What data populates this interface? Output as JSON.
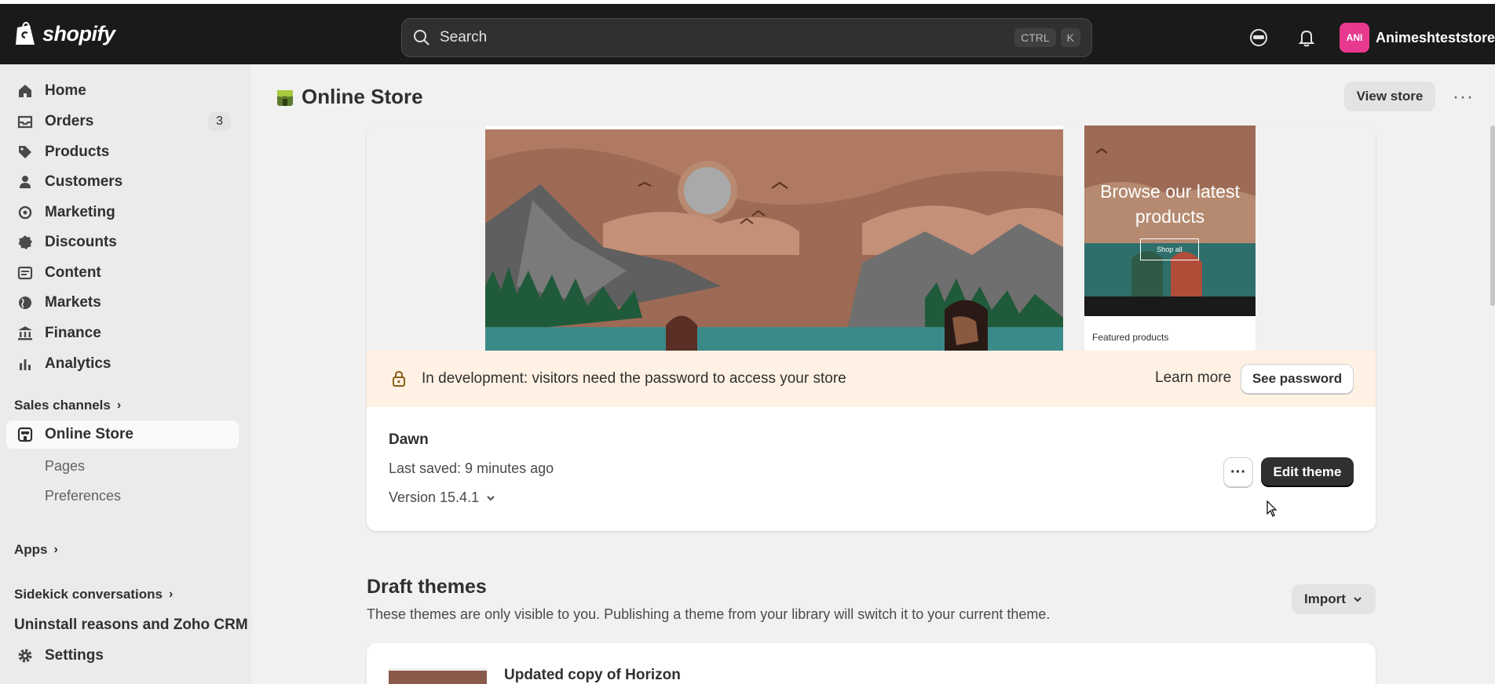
{
  "topbar": {
    "logo_text": "shopify",
    "search_placeholder": "Search",
    "kbd_ctrl": "CTRL",
    "kbd_k": "K",
    "avatar_initials": "ANI",
    "store_name": "Animeshteststore"
  },
  "sidebar": {
    "items": [
      {
        "label": "Home",
        "icon": "home-icon"
      },
      {
        "label": "Orders",
        "icon": "inbox-icon",
        "badge": "3"
      },
      {
        "label": "Products",
        "icon": "tag-icon"
      },
      {
        "label": "Customers",
        "icon": "person-icon"
      },
      {
        "label": "Marketing",
        "icon": "target-icon"
      },
      {
        "label": "Discounts",
        "icon": "discount-icon"
      },
      {
        "label": "Content",
        "icon": "content-icon"
      },
      {
        "label": "Markets",
        "icon": "globe-icon"
      },
      {
        "label": "Finance",
        "icon": "bank-icon"
      },
      {
        "label": "Analytics",
        "icon": "chart-icon"
      }
    ],
    "sales_channels_label": "Sales channels",
    "online_store_label": "Online Store",
    "sub_items": [
      "Pages",
      "Preferences"
    ],
    "apps_label": "Apps",
    "sidekick_label": "Sidekick conversations",
    "uninstall_label": "Uninstall reasons and Zoho CRM",
    "settings_label": "Settings"
  },
  "header": {
    "title": "Online Store",
    "view_store_label": "View store",
    "more_label": "···"
  },
  "current_theme": {
    "mobile_heading": "Browse our latest products",
    "mobile_button": "Shop all",
    "featured_label": "Featured products",
    "banner_text": "In development: visitors need the password to access your store",
    "learn_more": "Learn more",
    "see_password": "See password",
    "name": "Dawn",
    "last_saved": "Last saved: 9 minutes ago",
    "version": "Version 15.4.1",
    "edit_theme": "Edit theme",
    "more_label": "···"
  },
  "drafts": {
    "title": "Draft themes",
    "description": "These themes are only visible to you. Publishing a theme from your library will switch it to your current theme.",
    "import_label": "Import",
    "first_theme_name": "Updated copy of Horizon"
  }
}
